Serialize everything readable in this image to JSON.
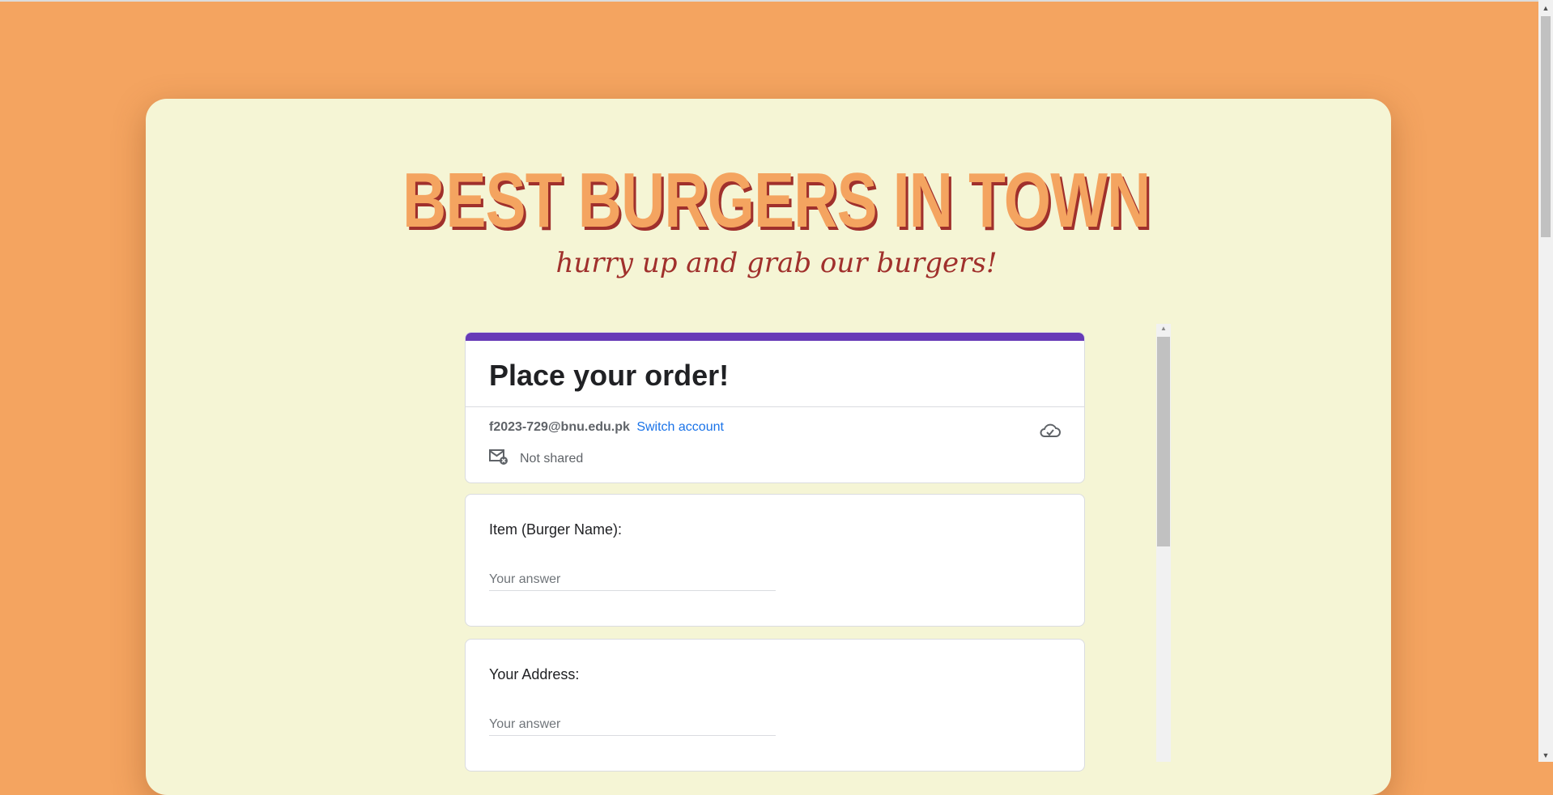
{
  "page": {
    "colors": {
      "background": "#F4A460",
      "card": "#F5F5D5",
      "accent_title": "#F4A460",
      "title_shadow": "#A0302C",
      "form_accent": "#673AB7",
      "link": "#1a73e8"
    }
  },
  "hero": {
    "title": "BEST BURGERS IN TOWN",
    "subtitle": "hurry up and grab our burgers!"
  },
  "form": {
    "title": "Place your order!",
    "account": {
      "email": "f2023-729@bnu.edu.pk",
      "switch_label": "Switch account",
      "shared_status": "Not shared",
      "icons": [
        "cloud-check-icon",
        "mail-off-icon"
      ]
    },
    "questions": [
      {
        "label": "Item (Burger Name):",
        "placeholder": "Your answer",
        "value": ""
      },
      {
        "label": "Your Address:",
        "placeholder": "Your answer",
        "value": ""
      }
    ]
  }
}
